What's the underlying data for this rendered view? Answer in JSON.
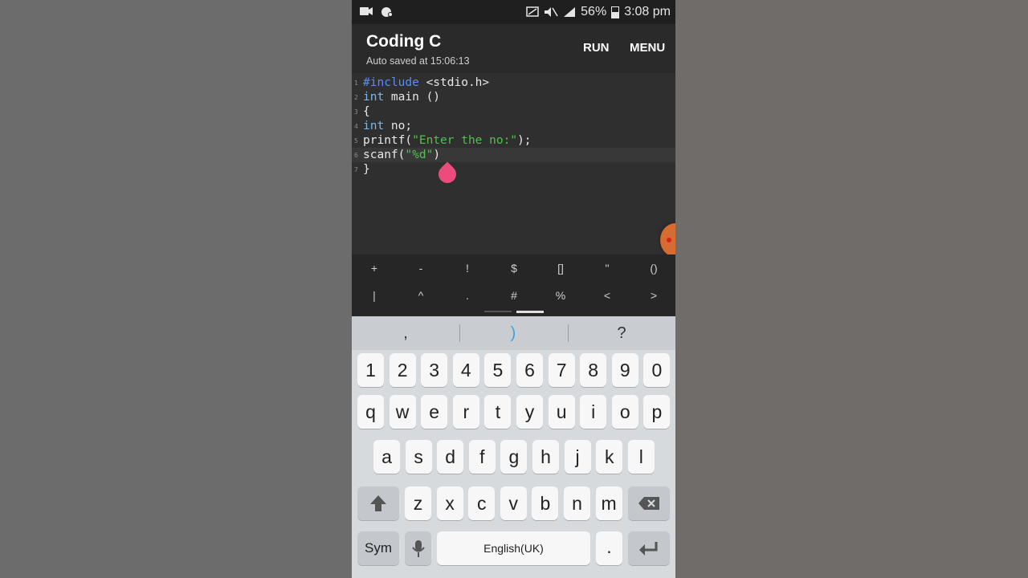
{
  "status_bar": {
    "battery_text": "56%",
    "time": "3:08 pm",
    "icons": [
      "video-record-icon",
      "app-notification-icon",
      "cast-icon",
      "mute-icon",
      "signal-icon",
      "battery-icon"
    ]
  },
  "app_bar": {
    "title": "Coding C",
    "subtitle": "Auto saved at 15:06:13",
    "run_label": "RUN",
    "menu_label": "MENU"
  },
  "editor": {
    "line_numbers": [
      "1",
      "2",
      "3",
      "4",
      "5",
      "6",
      "7"
    ],
    "lines": [
      {
        "parts": [
          [
            "#include",
            "kw"
          ],
          [
            " <stdio.h>",
            ""
          ]
        ]
      },
      {
        "parts": [
          [
            "int",
            "ty"
          ],
          [
            " main ()",
            ""
          ]
        ]
      },
      {
        "parts": [
          [
            "{",
            ""
          ]
        ]
      },
      {
        "parts": [
          [
            "int",
            "ty"
          ],
          [
            " no;",
            ""
          ]
        ]
      },
      {
        "parts": [
          [
            "printf(",
            ""
          ],
          [
            "\"Enter the no:\"",
            "st"
          ],
          [
            ");",
            ""
          ]
        ]
      },
      {
        "parts": [
          [
            "scanf(",
            ""
          ],
          [
            "\"%d\"",
            "st"
          ],
          [
            ")",
            ""
          ]
        ]
      },
      {
        "parts": [
          [
            "}",
            ""
          ]
        ]
      }
    ],
    "active_line": 6
  },
  "symbol_bar": {
    "row1": [
      "+",
      "-",
      "!",
      "$",
      "[]",
      "''",
      "()"
    ],
    "row2": [
      "|",
      "^",
      ".",
      "#",
      "%",
      "<",
      ">"
    ]
  },
  "suggestions": [
    ",",
    ")",
    "?"
  ],
  "keyboard": {
    "row_numbers": [
      "1",
      "2",
      "3",
      "4",
      "5",
      "6",
      "7",
      "8",
      "9",
      "0"
    ],
    "row_q": [
      "q",
      "w",
      "e",
      "r",
      "t",
      "y",
      "u",
      "i",
      "o",
      "p"
    ],
    "row_a": [
      "a",
      "s",
      "d",
      "f",
      "g",
      "h",
      "j",
      "k",
      "l"
    ],
    "row_z": [
      "z",
      "x",
      "c",
      "v",
      "b",
      "n",
      "m"
    ],
    "sym_label": "Sym",
    "space_label": "English(UK)",
    "period_label": ".",
    "colors": {
      "key_bg": "#f7f7f7",
      "keyboard_bg": "#d7dadd",
      "accent": "#3ba7d8"
    }
  },
  "colors": {
    "keyword": "#5b8def",
    "type": "#7fb7e6",
    "string": "#4fc24f",
    "cursor_handle": "#ec4c7c"
  }
}
